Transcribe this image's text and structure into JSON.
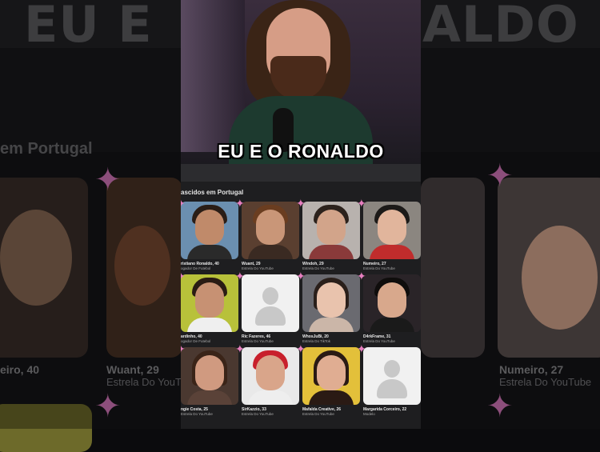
{
  "background": {
    "title_left": "EU E",
    "title_right": "ALDO",
    "subtitle": "em Portugal",
    "labels": [
      {
        "name": "eiro, 40",
        "role": ""
      },
      {
        "name": "Wuant, 29",
        "role": "Estrela Do YouTube"
      },
      {
        "name": "Numeiro, 27",
        "role": "Estrela Do YouTube"
      }
    ]
  },
  "video": {
    "caption": "EU E O RONALDO"
  },
  "section": {
    "title": "ascidos em Portugal"
  },
  "people": [
    {
      "name": "ristiano Ronaldo, 40",
      "role": "ogador De Futebol",
      "placeholder": false
    },
    {
      "name": "Wuant, 29",
      "role": "Estrela Do YouTube",
      "placeholder": false
    },
    {
      "name": "Windoh, 29",
      "role": "Estrela Do YouTube",
      "placeholder": false
    },
    {
      "name": "Numeiro, 27",
      "role": "Estrela Do YouTube",
      "placeholder": false
    },
    {
      "name": "ardinho, 40",
      "role": "ogador De Futebol",
      "placeholder": false
    },
    {
      "name": "Ric Fazeres, 46",
      "role": "Estrela Do YouTube",
      "placeholder": true
    },
    {
      "name": "WhosJuBi, 20",
      "role": "Estrela Do TikTok",
      "placeholder": false
    },
    {
      "name": "D4rkFrame, 31",
      "role": "Estrela Do YouTube",
      "placeholder": false
    },
    {
      "name": "ngie Costa, 25",
      "role": "Estrela Do YouTube",
      "placeholder": false
    },
    {
      "name": "SirKazzio, 33",
      "role": "Estrela Do YouTube",
      "placeholder": false
    },
    {
      "name": "Mafalda Creative, 26",
      "role": "Estrela Do YouTube",
      "placeholder": false
    },
    {
      "name": "Margarida Corceiro, 22",
      "role": "Modelo",
      "placeholder": true
    }
  ]
}
